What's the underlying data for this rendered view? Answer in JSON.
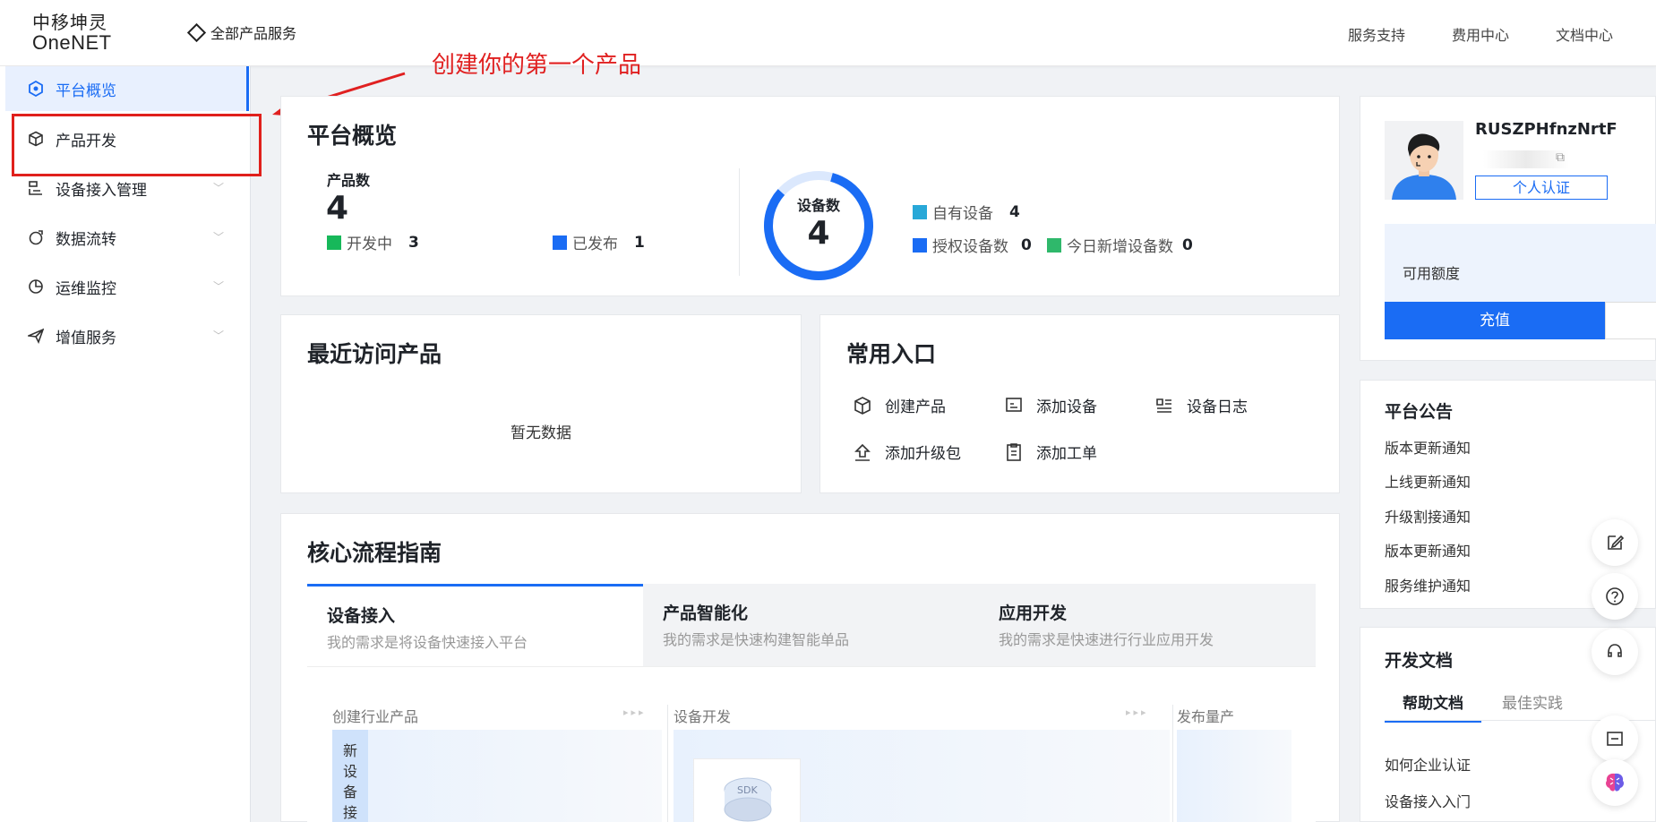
{
  "header": {
    "logo_cn": "中移坤灵",
    "logo_en": "OneNET",
    "all_products": "全部产品服务",
    "nav": [
      "服务支持",
      "费用中心",
      "文档中心"
    ]
  },
  "sidebar": {
    "items": [
      {
        "label": "平台概览",
        "icon": "platform-overview-icon"
      },
      {
        "label": "产品开发",
        "icon": "box-icon"
      },
      {
        "label": "设备接入管理",
        "icon": "device-access-icon"
      },
      {
        "label": "数据流转",
        "icon": "data-flow-icon"
      },
      {
        "label": "运维监控",
        "icon": "pie-chart-icon"
      },
      {
        "label": "增值服务",
        "icon": "send-icon"
      }
    ]
  },
  "annotation": {
    "text": "创建你的第一个产品",
    "color": "#e02020"
  },
  "overview": {
    "title": "平台概览",
    "product_count_label": "产品数",
    "product_count": "4",
    "developing_label": "开发中",
    "developing": "3",
    "published_label": "已发布",
    "published": "1",
    "device_count_label": "设备数",
    "device_count": "4",
    "own_devices_label": "自有设备",
    "own_devices": "4",
    "authorized_label": "授权设备数",
    "authorized": "0",
    "new_today_label": "今日新增设备数",
    "new_today": "0"
  },
  "recent": {
    "title": "最近访问产品",
    "empty": "暂无数据"
  },
  "entries": {
    "title": "常用入口",
    "items": [
      "创建产品",
      "添加设备",
      "设备日志",
      "添加升级包",
      "添加工单"
    ]
  },
  "guide": {
    "title": "核心流程指南",
    "tabs": [
      {
        "title": "设备接入",
        "desc": "我的需求是将设备快速接入平台"
      },
      {
        "title": "产品智能化",
        "desc": "我的需求是快速构建智能单品"
      },
      {
        "title": "应用开发",
        "desc": "我的需求是快速进行行业应用开发"
      }
    ],
    "flow": [
      "创建行业产品",
      "设备开发",
      "发布量产"
    ],
    "vertical_text": "新设备接",
    "sdk": "SDK"
  },
  "user": {
    "name": "RUSZPHfnzNrtF",
    "cert_button": "个人认证",
    "quota_label": "可用额度",
    "charge_button": "充值"
  },
  "notices": {
    "title": "平台公告",
    "items": [
      "版本更新通知",
      "上线更新通知",
      "升级割接通知",
      "版本更新通知",
      "服务维护通知"
    ]
  },
  "docs": {
    "title": "开发文档",
    "tabs": [
      "帮助文档",
      "最佳实践"
    ],
    "items": [
      "如何企业认证",
      "设备接入入门"
    ]
  },
  "colors": {
    "primary": "#1a6cf4",
    "highlight": "#e0201c"
  }
}
